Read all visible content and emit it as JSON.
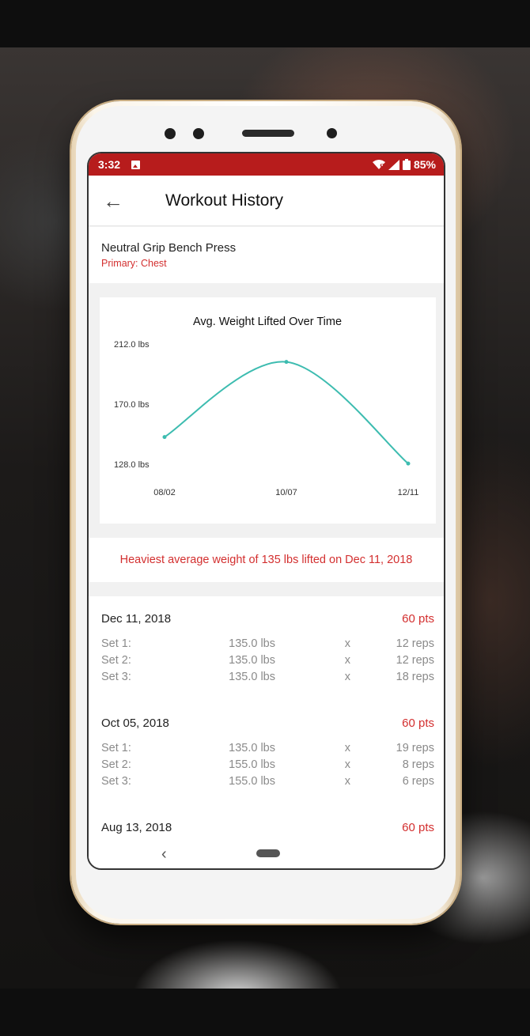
{
  "status_bar": {
    "time": "3:32",
    "battery": "85%"
  },
  "app_bar": {
    "title": "Workout History"
  },
  "exercise": {
    "name": "Neutral Grip Bench Press",
    "primary": "Primary: Chest"
  },
  "chart_data": {
    "type": "line",
    "title": "Avg. Weight Lifted Over Time",
    "x": [
      "08/02",
      "10/07",
      "12/11"
    ],
    "y_ticks": [
      "212.0 lbs",
      "170.0 lbs",
      "128.0 lbs"
    ],
    "ylim": [
      128,
      212
    ],
    "series": [
      {
        "points": [
          {
            "x": "08/02",
            "y": 152.5
          },
          {
            "x": "10/07",
            "y": 205.0
          },
          {
            "x": "12/11",
            "y": 134.0
          }
        ]
      }
    ],
    "colors": {
      "line": "#3dbcb0"
    }
  },
  "heaviest": "Heaviest average weight of 135 lbs lifted on Dec 11, 2018",
  "sessions": [
    {
      "date": "Dec 11, 2018",
      "pts": "60 pts",
      "sets": [
        {
          "label": "Set 1:",
          "weight": "135.0 lbs",
          "x": "x",
          "reps": "12 reps"
        },
        {
          "label": "Set 2:",
          "weight": "135.0 lbs",
          "x": "x",
          "reps": "12 reps"
        },
        {
          "label": "Set 3:",
          "weight": "135.0 lbs",
          "x": "x",
          "reps": "18 reps"
        }
      ]
    },
    {
      "date": "Oct 05, 2018",
      "pts": "60 pts",
      "sets": [
        {
          "label": "Set 1:",
          "weight": "135.0 lbs",
          "x": "x",
          "reps": "19 reps"
        },
        {
          "label": "Set 2:",
          "weight": "155.0 lbs",
          "x": "x",
          "reps": "8 reps"
        },
        {
          "label": "Set 3:",
          "weight": "155.0 lbs",
          "x": "x",
          "reps": "6 reps"
        }
      ]
    },
    {
      "date": "Aug 13, 2018",
      "pts": "60 pts",
      "sets": []
    }
  ],
  "nav": {
    "back_icon": "‹"
  },
  "colors": {
    "accent": "#b71c1c",
    "accent_text": "#d32f2f",
    "line": "#3dbcb0"
  }
}
